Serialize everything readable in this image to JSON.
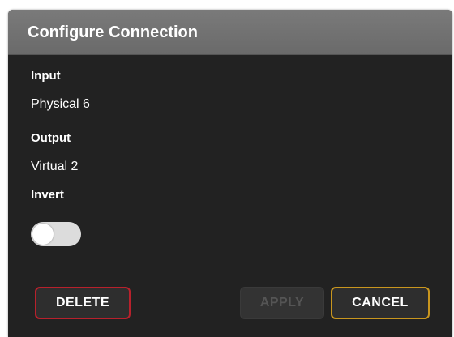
{
  "dialog": {
    "title": "Configure Connection"
  },
  "fields": {
    "input": {
      "label": "Input",
      "value": "Physical 6"
    },
    "output": {
      "label": "Output",
      "value": "Virtual 2"
    },
    "invert": {
      "label": "Invert",
      "enabled": false
    }
  },
  "buttons": {
    "delete": "DELETE",
    "apply": "APPLY",
    "cancel": "CANCEL"
  },
  "colors": {
    "dialog_background": "#222222",
    "header_background": "#6f6f6f",
    "delete_border": "#b8212c",
    "cancel_border": "#c9961e",
    "disabled_text": "#555555"
  }
}
